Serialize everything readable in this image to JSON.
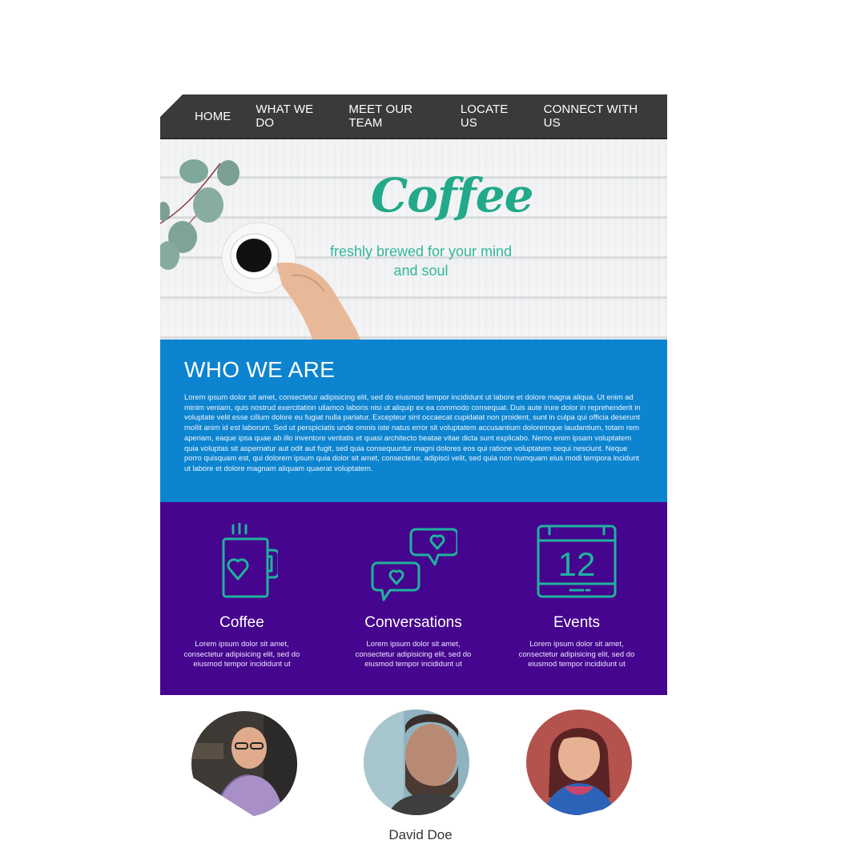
{
  "nav": {
    "items": [
      "HOME",
      "WHAT WE DO",
      "MEET OUR TEAM",
      "LOCATE US",
      "CONNECT WITH US"
    ]
  },
  "hero": {
    "title": "Coffee",
    "subtitle": "freshly brewed for your mind and soul"
  },
  "who": {
    "heading": "WHO WE ARE",
    "body": "Lorem ipsum dolor sit amet, consectetur adipisicing elit, sed do eiusmod tempor incididunt ut labore et dolore magna aliqua. Ut enim ad minim veniam, quis nostrud exercitation ullamco laboris nisi ut aliquip ex ea commodo consequat. Duis aute irure dolor in reprehenderit in voluptate velit esse cillum dolore eu fugiat nulla pariatur. Excepteur sint occaecat cupidatat non proident, sunt in culpa qui officia deserunt mollit anim id est laborum. Sed ut perspiciatis unde omnis iste natus error sit voluptatem accusantium doloremque laudantium, totam rem aperiam, eaque ipsa quae ab illo inventore veritatis et quasi architecto beatae vitae dicta sunt explicabo. Nemo enim ipsam voluptatem quia voluptas sit aspernatur aut odit aut fugit, sed quia consequuntur magni dolores eos qui ratione voluptatem sequi nesciunt. Neque porro quisquam est, qui dolorem ipsum quia dolor sit amet, consectetur, adipisci velit, sed quia non numquam eius modi tempora incidunt ut labore et dolore magnam aliquam quaerat voluptatem."
  },
  "features": [
    {
      "icon": "coffee-mug-heart-icon",
      "title": "Coffee",
      "text": "Lorem ipsum dolor sit amet, consectetur adipisicing elit, sed do eiusmod tempor incididunt ut"
    },
    {
      "icon": "chat-bubbles-heart-icon",
      "title": "Conversations",
      "text": "Lorem ipsum dolor sit amet, consectetur adipisicing elit, sed do eiusmod tempor incididunt ut"
    },
    {
      "icon": "calendar-icon",
      "title": "Events",
      "calendar_day": "12",
      "text": "Lorem ipsum dolor sit amet, consectetur adipisicing elit, sed do eiusmod tempor incididunt ut"
    }
  ],
  "team": {
    "names": [
      "David Doe"
    ]
  },
  "colors": {
    "nav_bg": "#3a3a3a",
    "who_bg": "#0d84d0",
    "features_bg": "#45058e",
    "accent_teal": "#22a98a",
    "icon_teal": "#1fb39c"
  }
}
